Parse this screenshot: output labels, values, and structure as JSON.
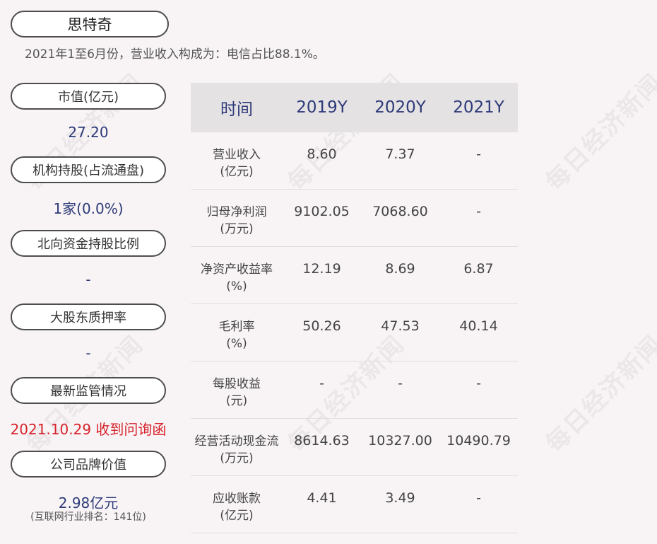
{
  "company": {
    "name": "思特奇",
    "subtitle": "2021年1至6月份，营业收入构成为：电信占比88.1%。"
  },
  "watermark_text": "每日经济新闻",
  "side": {
    "market_cap": {
      "label": "市值(亿元)",
      "value": "27.20"
    },
    "institution": {
      "label": "机构持股(占流通盘)",
      "value": "1家(0.0%)"
    },
    "northbound": {
      "label": "北向资金持股比例",
      "value": "-"
    },
    "pledge": {
      "label": "大股东质押率",
      "value": "-"
    },
    "regulation": {
      "label": "最新监管情况",
      "value": "2021.10.29 收到问询函"
    },
    "brand": {
      "label": "公司品牌价值",
      "value": "2.98亿元",
      "note": "(互联网行业排名：141位)"
    }
  },
  "table": {
    "headers": [
      "时间",
      "2019Y",
      "2020Y",
      "2021Y"
    ],
    "rows": [
      {
        "label1": "营业收入",
        "label2": "(亿元)",
        "v2019": "8.60",
        "v2020": "7.37",
        "v2021": "-"
      },
      {
        "label1": "归母净利润",
        "label2": "(万元)",
        "v2019": "9102.05",
        "v2020": "7068.60",
        "v2021": "-"
      },
      {
        "label1": "净资产收益率",
        "label2": "(%)",
        "v2019": "12.19",
        "v2020": "8.69",
        "v2021": "6.87"
      },
      {
        "label1": "毛利率",
        "label2": "(%)",
        "v2019": "50.26",
        "v2020": "47.53",
        "v2021": "40.14"
      },
      {
        "label1": "每股收益",
        "label2": "(元)",
        "v2019": "-",
        "v2020": "-",
        "v2021": "-"
      },
      {
        "label1": "经营活动现金流",
        "label2": "(万元)",
        "v2019": "8614.63",
        "v2020": "10327.00",
        "v2021": "10490.79"
      },
      {
        "label1": "应收账款",
        "label2": "(亿元)",
        "v2019": "4.41",
        "v2020": "3.49",
        "v2021": "-"
      }
    ]
  },
  "colors": {
    "background": "#f8f4f6",
    "accent_blue": "#2d3a78",
    "alert_red": "#d6232b",
    "header_bg": "#e5e2e4"
  }
}
